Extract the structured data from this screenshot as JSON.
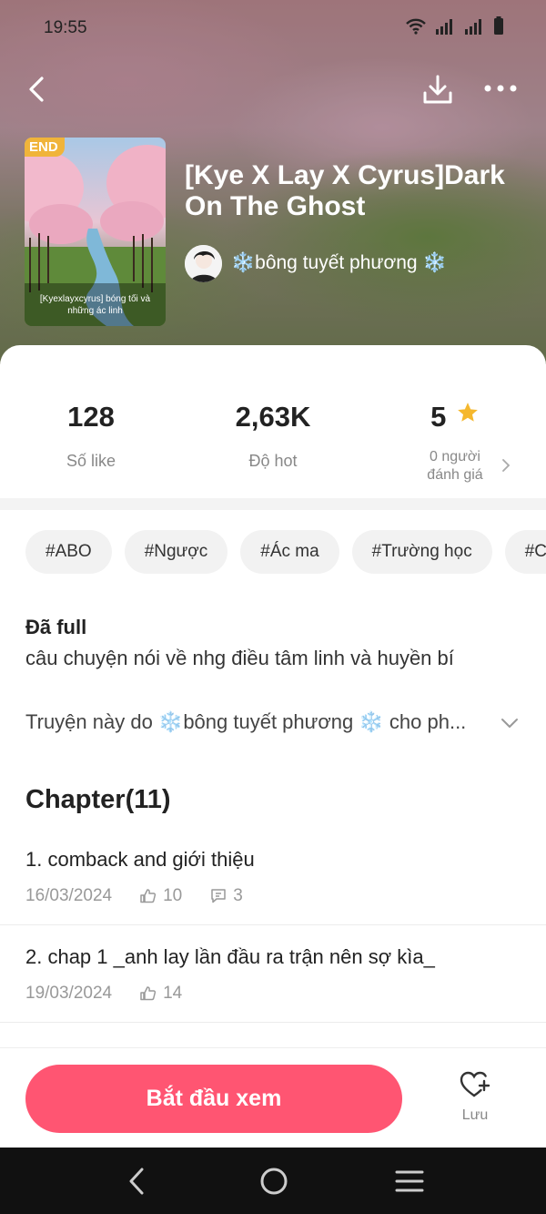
{
  "statusbar": {
    "time": "19:55"
  },
  "book": {
    "badge": "END",
    "cover_caption": "[Kyexlayxcyrus] bóng tối và những ác linh",
    "title": "[Kye X Lay X Cyrus]Dark On The Ghost",
    "author": "❄️bông tuyết phương ❄️"
  },
  "stats": {
    "likes": {
      "value": "128",
      "label": "Số like"
    },
    "hot": {
      "value": "2,63K",
      "label": "Độ hot"
    },
    "rating": {
      "value": "5",
      "label_line1": "0 người",
      "label_line2": "đánh giá"
    }
  },
  "tags": [
    "#ABO",
    "#Ngược",
    "#Ác ma",
    "#Trường học",
    "#C"
  ],
  "info": {
    "status": "Đã full",
    "description": "câu chuyện nói về nhg điều tâm linh và huyền bí",
    "credit": "Truyện này do ❄️bông tuyết phương ❄️ cho ph..."
  },
  "chapters": {
    "heading": "Chapter(11)",
    "items": [
      {
        "title": "1. comback and giới thiệu",
        "date": "16/03/2024",
        "likes": "10",
        "comments": "3"
      },
      {
        "title": "2. chap 1 _anh lay lần đầu ra trận nên sợ kìa_",
        "date": "19/03/2024",
        "likes": "14"
      }
    ]
  },
  "actions": {
    "start": "Bắt đầu xem",
    "save": "Lưu"
  },
  "colors": {
    "accent": "#ff5572",
    "badge": "#f0b43a",
    "star": "#f5b82e"
  }
}
